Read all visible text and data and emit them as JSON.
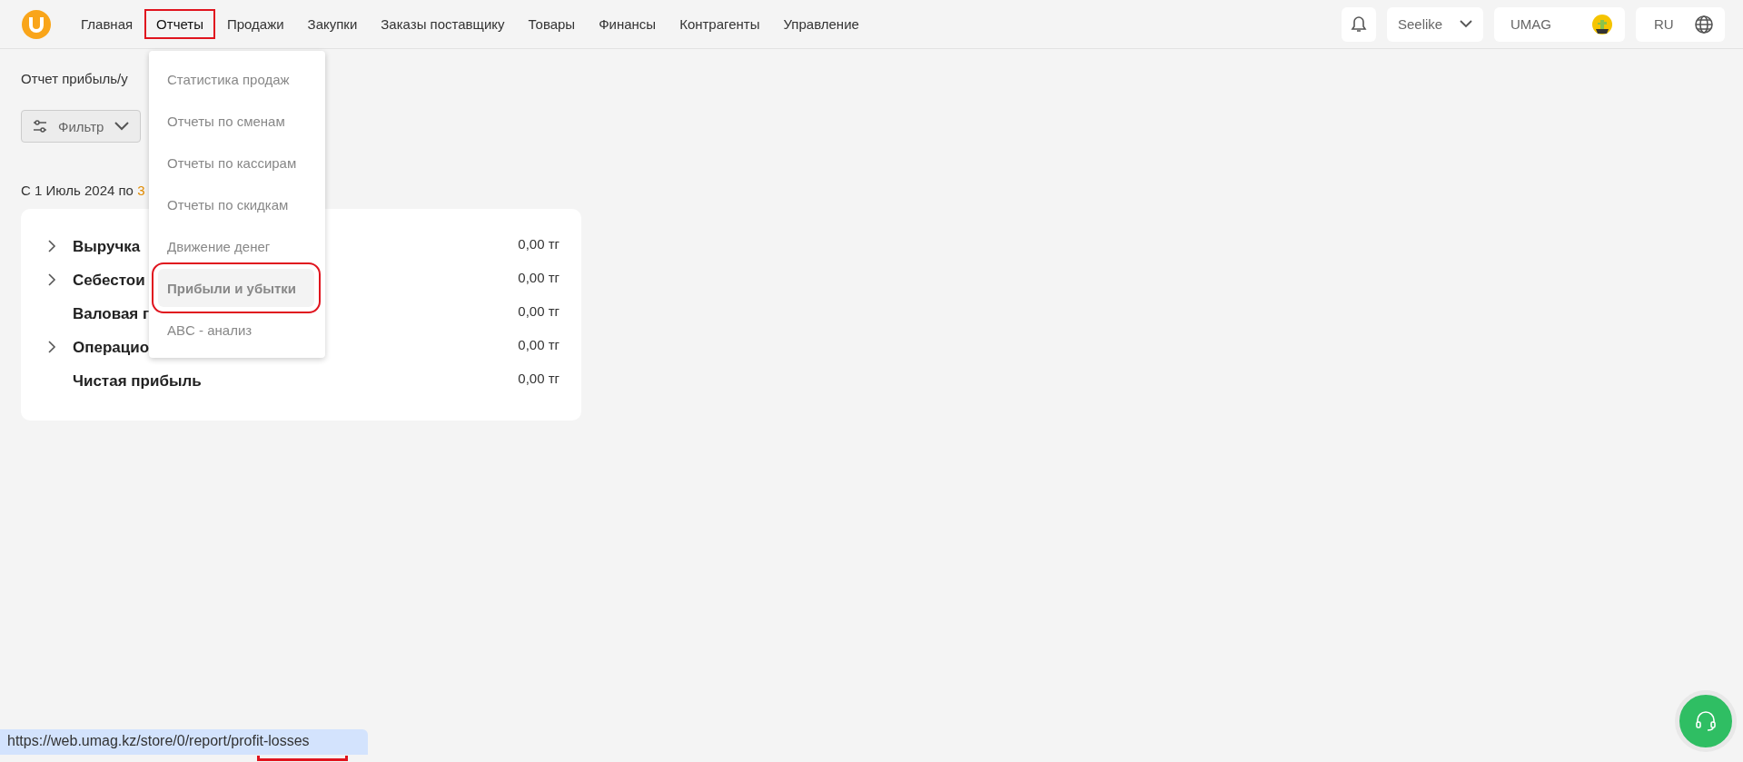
{
  "nav": [
    {
      "label": "Главная",
      "selected": false,
      "highlighted": false
    },
    {
      "label": "Отчеты",
      "selected": true,
      "highlighted": true
    },
    {
      "label": "Продажи",
      "selected": false,
      "highlighted": false
    },
    {
      "label": "Закупки",
      "selected": false,
      "highlighted": false
    },
    {
      "label": "Заказы поставщику",
      "selected": false,
      "highlighted": false
    },
    {
      "label": "Товары",
      "selected": false,
      "highlighted": false
    },
    {
      "label": "Финансы",
      "selected": false,
      "highlighted": false
    },
    {
      "label": "Контрагенты",
      "selected": false,
      "highlighted": false
    },
    {
      "label": "Управление",
      "selected": false,
      "highlighted": false
    }
  ],
  "header": {
    "store": "Seelike",
    "account": "UMAG",
    "language": "RU"
  },
  "menu": [
    {
      "label": "Статистика продаж",
      "selected": false,
      "highlighted": false
    },
    {
      "label": "Отчеты по сменам",
      "selected": false,
      "highlighted": false
    },
    {
      "label": "Отчеты по кассирам",
      "selected": false,
      "highlighted": false
    },
    {
      "label": "Отчеты по скидкам",
      "selected": false,
      "highlighted": false
    },
    {
      "label": "Движение денег",
      "selected": false,
      "highlighted": false
    },
    {
      "label": "Прибыли и убытки",
      "selected": true,
      "highlighted": true
    },
    {
      "label": "ABC - анализ",
      "selected": false,
      "highlighted": false
    }
  ],
  "page_title": "Отчет прибыль/у",
  "filter_button": "Фильтр",
  "period": {
    "text": "С 1 Июль 2024 по ",
    "link": "3"
  },
  "rows": [
    {
      "label": "Выручка",
      "value": "0,00 тг",
      "expandable": true
    },
    {
      "label": "Себестои",
      "value": "0,00 тг",
      "expandable": true
    },
    {
      "label": "Валовая г",
      "value": "0,00 тг",
      "expandable": false
    },
    {
      "label": "Операцио",
      "value": "0,00 тг",
      "expandable": true
    },
    {
      "label": "Чистая прибыль",
      "value": "0,00 тг",
      "expandable": false
    }
  ],
  "status_bar": {
    "url": "https://web.umag.kz/store/0/report/profit-losses"
  }
}
